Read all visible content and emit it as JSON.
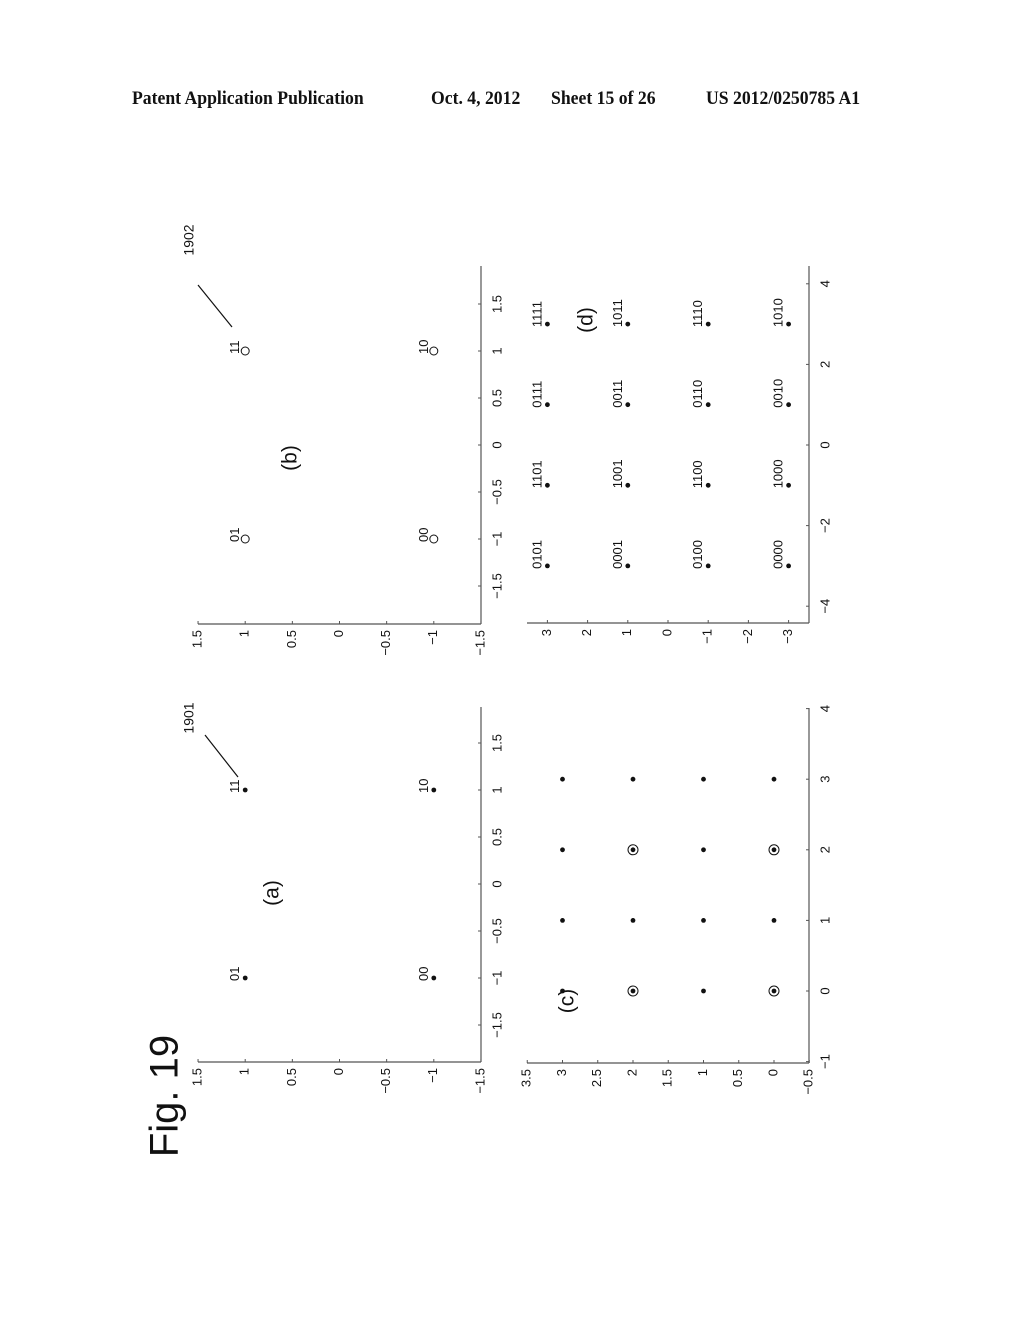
{
  "header": {
    "publication": "Patent Application Publication",
    "date": "Oct. 4, 2012",
    "sheet": "Sheet 15 of 26",
    "number": "US 2012/0250785 A1"
  },
  "figure": {
    "title": "Fig. 19",
    "orientation": "rotated 90 degrees counter-clockwise",
    "references": [
      {
        "label": "1901",
        "panel": "a",
        "points_to": "11"
      },
      {
        "label": "1902",
        "panel": "b",
        "points_to": "11"
      }
    ]
  },
  "chart_data": [
    {
      "id": "a",
      "type": "scatter",
      "title": "(a)",
      "marker": "dot",
      "xlim": [
        -1.9,
        1.9
      ],
      "ylim": [
        -1.5,
        1.5
      ],
      "xticks": [
        -1.5,
        -1,
        -0.5,
        0,
        0.5,
        1,
        1.5
      ],
      "xtick_labels": [
        "−1.5",
        "−1",
        "−0.5",
        "0",
        "0.5",
        "1",
        "1.5"
      ],
      "yticks": [
        -1.5,
        -1,
        -0.5,
        0,
        0.5,
        1,
        1.5
      ],
      "ytick_labels": [
        "−1.5",
        "−1",
        "−0.5",
        "0",
        "0.5",
        "1",
        "1.5"
      ],
      "points": [
        {
          "x": -1,
          "y": 1,
          "label": "01"
        },
        {
          "x": 1,
          "y": 1,
          "label": "11"
        },
        {
          "x": -1,
          "y": -1,
          "label": "00"
        },
        {
          "x": 1,
          "y": -1,
          "label": "10"
        }
      ]
    },
    {
      "id": "b",
      "type": "scatter",
      "title": "(b)",
      "marker": "open-circle",
      "xlim": [
        -1.9,
        1.9
      ],
      "ylim": [
        -1.5,
        1.5
      ],
      "xticks": [
        -1.5,
        -1,
        -0.5,
        0,
        0.5,
        1,
        1.5
      ],
      "xtick_labels": [
        "−1.5",
        "−1",
        "−0.5",
        "0",
        "0.5",
        "1",
        "1.5"
      ],
      "yticks": [
        -1.5,
        -1,
        -0.5,
        0,
        0.5,
        1,
        1.5
      ],
      "ytick_labels": [
        "−1.5",
        "−1",
        "−0.5",
        "0",
        "0.5",
        "1",
        "1.5"
      ],
      "points": [
        {
          "x": -1,
          "y": 1,
          "label": "01"
        },
        {
          "x": 1,
          "y": 1,
          "label": "11"
        },
        {
          "x": -1,
          "y": -1,
          "label": "00"
        },
        {
          "x": 1,
          "y": -1,
          "label": "10"
        }
      ]
    },
    {
      "id": "c",
      "type": "scatter",
      "title": "(c)",
      "marker": "dot",
      "xlim": [
        -1,
        4
      ],
      "ylim": [
        -0.5,
        3.5
      ],
      "xticks": [
        -1,
        0,
        1,
        2,
        3,
        4
      ],
      "xtick_labels": [
        "−1",
        "0",
        "1",
        "2",
        "3",
        "4"
      ],
      "yticks": [
        -0.5,
        0,
        0.5,
        1,
        1.5,
        2,
        2.5,
        3,
        3.5
      ],
      "ytick_labels": [
        "−0.5",
        "0",
        "0.5",
        "1",
        "1.5",
        "2",
        "2.5",
        "3",
        "3.5"
      ],
      "points": [
        {
          "x": 0,
          "y": 3,
          "circled": false
        },
        {
          "x": 1,
          "y": 3,
          "circled": false
        },
        {
          "x": 2,
          "y": 3,
          "circled": false
        },
        {
          "x": 3,
          "y": 3,
          "circled": false
        },
        {
          "x": 0,
          "y": 2,
          "circled": true
        },
        {
          "x": 1,
          "y": 2,
          "circled": false
        },
        {
          "x": 2,
          "y": 2,
          "circled": true
        },
        {
          "x": 3,
          "y": 2,
          "circled": false
        },
        {
          "x": 0,
          "y": 1,
          "circled": false
        },
        {
          "x": 1,
          "y": 1,
          "circled": false
        },
        {
          "x": 2,
          "y": 1,
          "circled": false
        },
        {
          "x": 3,
          "y": 1,
          "circled": false
        },
        {
          "x": 0,
          "y": 0,
          "circled": true
        },
        {
          "x": 1,
          "y": 0,
          "circled": false
        },
        {
          "x": 2,
          "y": 0,
          "circled": true
        },
        {
          "x": 3,
          "y": 0,
          "circled": false
        }
      ]
    },
    {
      "id": "d",
      "type": "scatter",
      "title": "(d)",
      "marker": "dot",
      "xlim": [
        -4.4,
        4.4
      ],
      "ylim": [
        -3.5,
        3.5
      ],
      "xticks": [
        -4,
        -2,
        0,
        2,
        4
      ],
      "xtick_labels": [
        "−4",
        "−2",
        "0",
        "2",
        "4"
      ],
      "yticks": [
        -3,
        -2,
        -1,
        0,
        1,
        2,
        3
      ],
      "ytick_labels": [
        "−3",
        "−2",
        "−1",
        "0",
        "1",
        "2",
        "3"
      ],
      "points": [
        {
          "x": -3,
          "y": 3,
          "label": "0101"
        },
        {
          "x": -1,
          "y": 3,
          "label": "1101"
        },
        {
          "x": 1,
          "y": 3,
          "label": "0111"
        },
        {
          "x": 3,
          "y": 3,
          "label": "1111"
        },
        {
          "x": -3,
          "y": 1,
          "label": "0001"
        },
        {
          "x": -1,
          "y": 1,
          "label": "1001"
        },
        {
          "x": 1,
          "y": 1,
          "label": "0011"
        },
        {
          "x": 3,
          "y": 1,
          "label": "1011"
        },
        {
          "x": -3,
          "y": -1,
          "label": "0100"
        },
        {
          "x": -1,
          "y": -1,
          "label": "1100"
        },
        {
          "x": 1,
          "y": -1,
          "label": "0110"
        },
        {
          "x": 3,
          "y": -1,
          "label": "1110"
        },
        {
          "x": -3,
          "y": -3,
          "label": "0000"
        },
        {
          "x": -1,
          "y": -3,
          "label": "1000"
        },
        {
          "x": 1,
          "y": -3,
          "label": "0010"
        },
        {
          "x": 3,
          "y": -3,
          "label": "1010"
        }
      ]
    }
  ]
}
